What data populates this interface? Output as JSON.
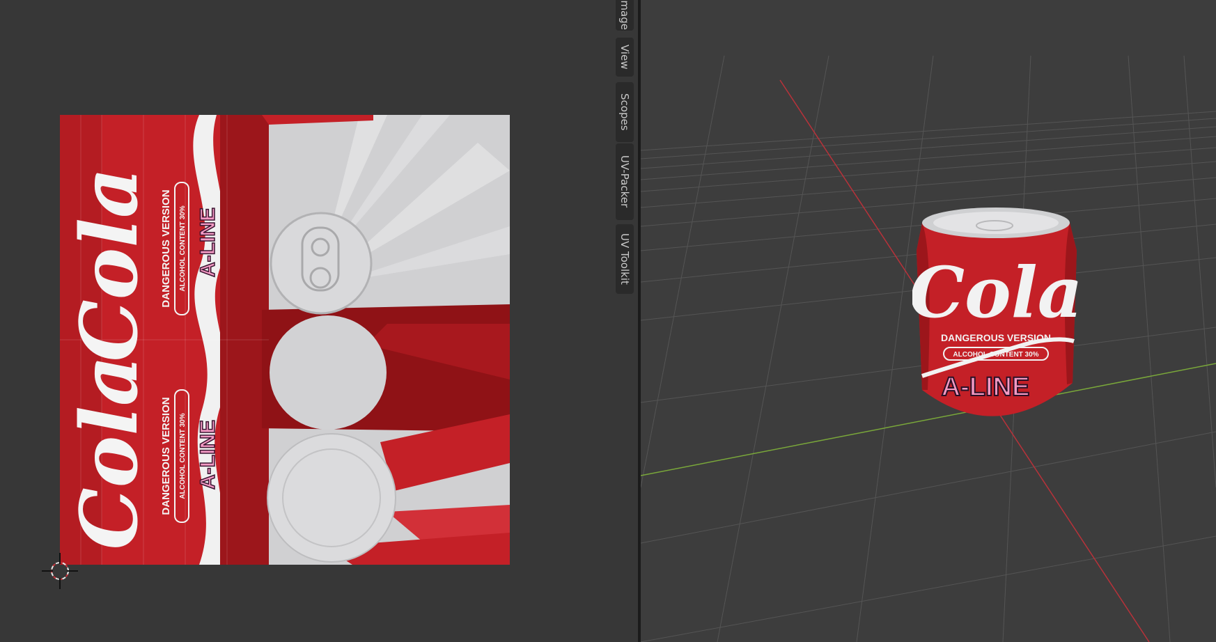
{
  "uv_editor": {
    "sidebar_tabs": [
      "Image",
      "View",
      "Scopes",
      "UV-Packer",
      "UV Toolkit"
    ]
  },
  "texture": {
    "brand": "Cola",
    "tagline": "DANGEROUS VERSION",
    "subtag": "ALCOHOL CONTENT 30%",
    "logo": "A-LINE"
  },
  "toolbar": {
    "tools": [
      "move-icon",
      "rotate-icon",
      "scale-icon",
      "transform-icon",
      "annotate-icon",
      "measure-icon",
      "add-cube-icon"
    ]
  },
  "colors": {
    "can_red": "#c42027",
    "dark_red": "#8f1216",
    "silver": "#d2d2d4",
    "x_axis": "#b8323a",
    "y_axis": "#7aa83a",
    "accent": "#6fc2a8"
  }
}
